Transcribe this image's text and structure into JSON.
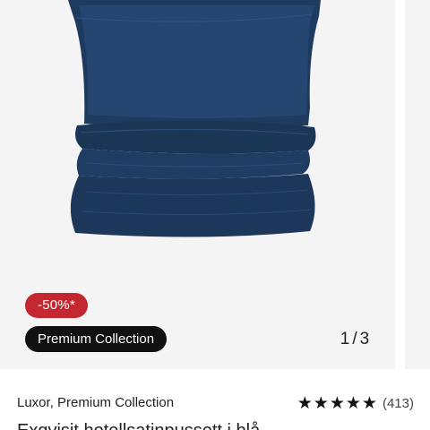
{
  "gallery": {
    "discount_badge": "-50%*",
    "collection_tag": "Premium Collection",
    "pager": {
      "current": "1",
      "separator": "/",
      "total": "3"
    }
  },
  "product": {
    "brand_line": "Luxor, Premium Collection",
    "rating": {
      "stars": 5,
      "review_count": "(413)"
    },
    "title_peek": "Exqvisit hotellsatinpussett i blå"
  },
  "colors": {
    "bedding": "#1f3a5f",
    "discount_badge": "#c3272f",
    "tag_background": "#111111"
  }
}
